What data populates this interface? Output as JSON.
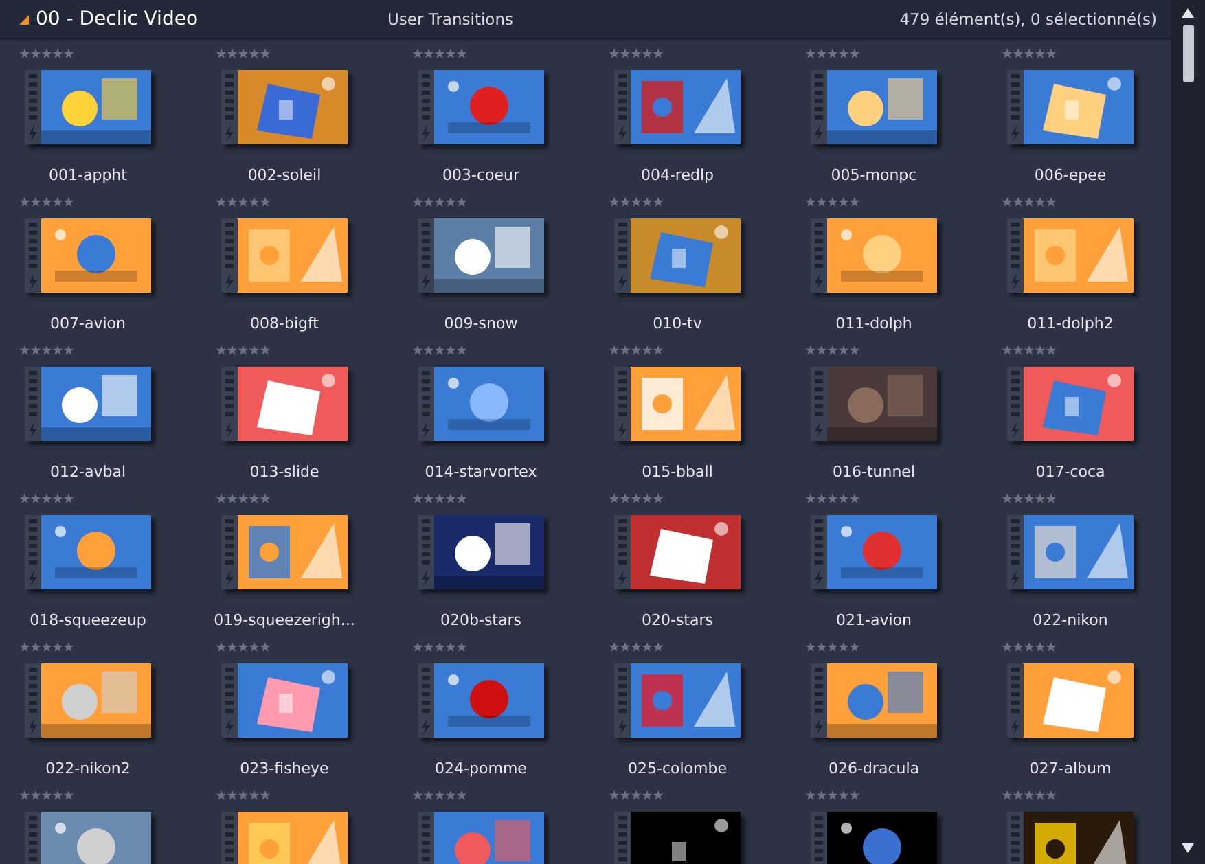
{
  "header": {
    "title": "00 - Declic Video",
    "category": "User Transitions",
    "count": "479 élément(s), 0 sélectionné(s)",
    "expanded": true
  },
  "items": [
    {
      "kind": "transition",
      "name": "001-appht"
    },
    {
      "kind": "transition",
      "name": "002-soleil"
    },
    {
      "kind": "transition",
      "name": "003-coeur"
    },
    {
      "kind": "transition",
      "name": "004-redlp"
    },
    {
      "kind": "transition",
      "name": "005-monpc"
    },
    {
      "kind": "transition",
      "name": "006-epee"
    },
    {
      "kind": "transition",
      "name": "007-avion"
    },
    {
      "kind": "transition",
      "name": "008-bigft"
    },
    {
      "kind": "transition",
      "name": "009-snow"
    },
    {
      "kind": "transition",
      "name": "010-tv"
    },
    {
      "kind": "transition",
      "name": "011-dolph"
    },
    {
      "kind": "transition",
      "name": "011-dolph2"
    },
    {
      "kind": "transition",
      "name": "012-avbal"
    },
    {
      "kind": "transition",
      "name": "013-slide"
    },
    {
      "kind": "transition",
      "name": "014-starvortex"
    },
    {
      "kind": "transition",
      "name": "015-bball"
    },
    {
      "kind": "transition",
      "name": "016-tunnel"
    },
    {
      "kind": "transition",
      "name": "017-coca"
    },
    {
      "kind": "transition",
      "name": "018-squeezeup"
    },
    {
      "kind": "transition",
      "name": "019-squeezerigh..."
    },
    {
      "kind": "transition",
      "name": "020b-stars"
    },
    {
      "kind": "transition",
      "name": "020-stars"
    },
    {
      "kind": "transition",
      "name": "021-avion"
    },
    {
      "kind": "transition",
      "name": "022-nikon"
    },
    {
      "kind": "transition",
      "name": "022-nikon2"
    },
    {
      "kind": "transition",
      "name": "023-fisheye"
    },
    {
      "kind": "transition",
      "name": "024-pomme"
    },
    {
      "kind": "transition",
      "name": "025-colombe"
    },
    {
      "kind": "transition",
      "name": "026-dracula"
    },
    {
      "kind": "transition",
      "name": "027-album"
    },
    {
      "kind": "picture"
    },
    {
      "kind": "picture"
    },
    {
      "kind": "picture"
    },
    {
      "kind": "picture"
    },
    {
      "kind": "picture"
    },
    {
      "kind": "picture"
    }
  ]
}
